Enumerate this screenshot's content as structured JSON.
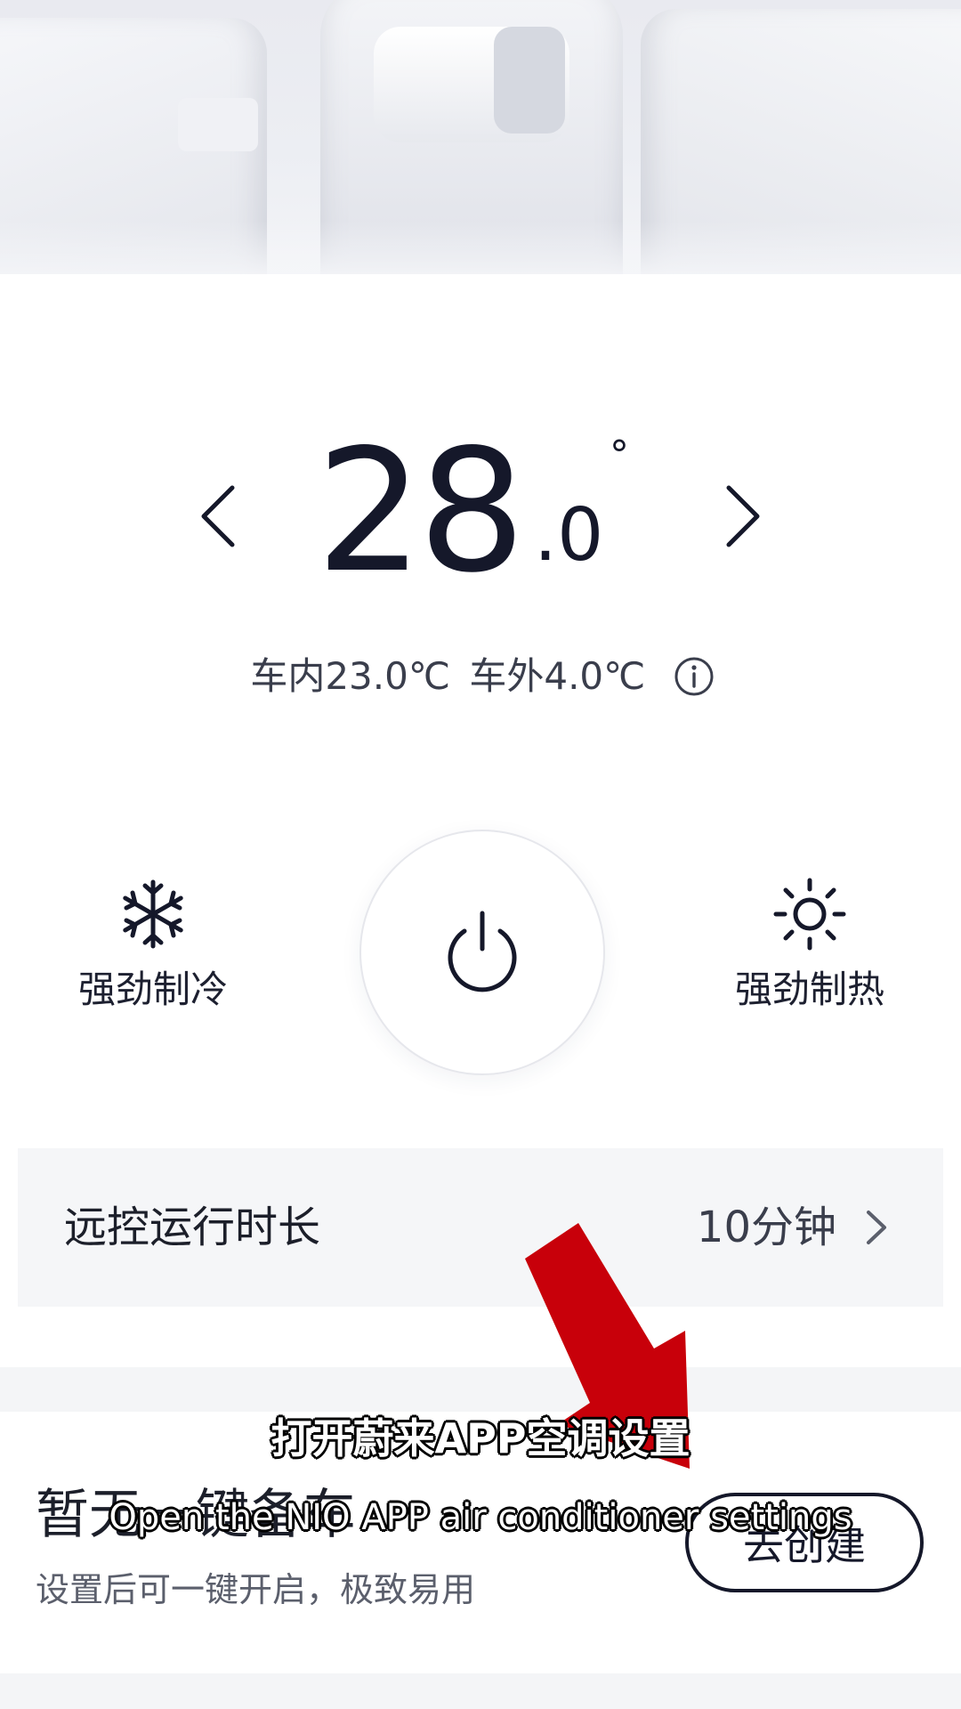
{
  "temperature": {
    "integer": "28",
    "decimal": ".0",
    "degree_symbol": "°",
    "decrease_icon": "chevron-left-icon",
    "increase_icon": "chevron-right-icon"
  },
  "readout": {
    "inside": "车内23.0℃",
    "outside": "车外4.0℃",
    "info_icon": "info-icon"
  },
  "modes": {
    "cool": {
      "label": "强劲制冷",
      "icon": "snowflake-icon"
    },
    "heat": {
      "label": "强劲制热",
      "icon": "sun-icon"
    },
    "power_icon": "power-icon"
  },
  "runtime": {
    "title": "远控运行时长",
    "value": "10分钟",
    "icon": "chevron-right-icon"
  },
  "preset": {
    "title": "暂无一键备车",
    "description": "设置后可一键开启，极致易用",
    "button_label": "去创建"
  },
  "overlay": {
    "caption_zh": "打开蔚来APP空调设置",
    "caption_en": "Open the NIO APP air conditioner settings",
    "arrow_color": "#c8000a"
  },
  "colors": {
    "text_primary": "#15182a",
    "text_secondary": "#3a3e4c",
    "card_background": "#f5f6f8"
  }
}
